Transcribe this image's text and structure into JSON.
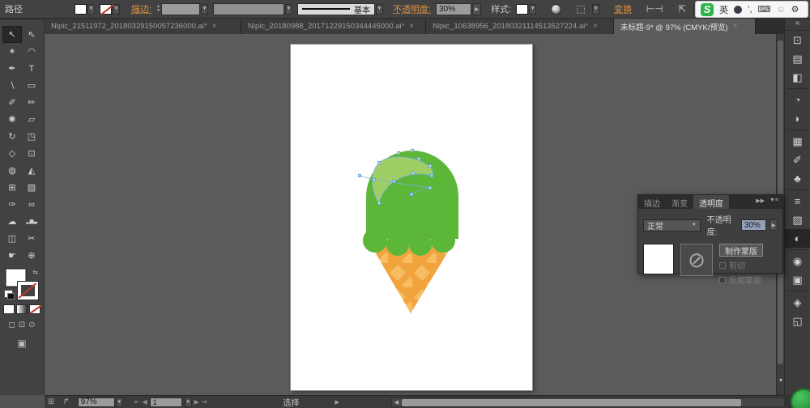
{
  "top_bar": {
    "context_label": "路径",
    "stroke_link": "描边:",
    "stroke_style_value": "基本",
    "opacity_link": "不透明度:",
    "opacity_value": "30%",
    "style_label": "样式:",
    "transform_link": "变换"
  },
  "ime": {
    "logo": "S",
    "mode": "英",
    "punct": "’,",
    "keyboard": "⌨",
    "skin": "☺",
    "tools": "⚙"
  },
  "tabs": {
    "items": [
      {
        "label": "Nipic_21511972_20180329150057236000.ai*",
        "close": "×",
        "active": false
      },
      {
        "label": "Nipic_20180988_20171229150344445000.ai*",
        "close": "×",
        "active": false
      },
      {
        "label": "Nipic_10638956_20180321114513527224.ai*",
        "close": "×",
        "active": false
      },
      {
        "label": "未标题-9* @ 97% (CMYK/预览)",
        "close": "×",
        "active": true
      }
    ],
    "overflow": "»"
  },
  "toolbar": {
    "tools": [
      {
        "name": "selection-tool",
        "glyph": "↖",
        "active": true
      },
      {
        "name": "direct-selection-tool",
        "glyph": "⇖"
      },
      {
        "name": "magic-wand-tool",
        "glyph": "✶"
      },
      {
        "name": "lasso-tool",
        "glyph": "◠"
      },
      {
        "name": "pen-tool",
        "glyph": "✒"
      },
      {
        "name": "type-tool",
        "glyph": "T"
      },
      {
        "name": "line-segment-tool",
        "glyph": "∖"
      },
      {
        "name": "rectangle-tool",
        "glyph": "▭"
      },
      {
        "name": "paintbrush-tool",
        "glyph": "✐"
      },
      {
        "name": "pencil-tool",
        "glyph": "✏"
      },
      {
        "name": "blob-brush-tool",
        "glyph": "✺"
      },
      {
        "name": "eraser-tool",
        "glyph": "▱"
      },
      {
        "name": "rotate-tool",
        "glyph": "↻"
      },
      {
        "name": "scale-tool",
        "glyph": "◳"
      },
      {
        "name": "width-tool",
        "glyph": "◇"
      },
      {
        "name": "free-transform-tool",
        "glyph": "⊡"
      },
      {
        "name": "shape-builder-tool",
        "glyph": "◍"
      },
      {
        "name": "perspective-grid-tool",
        "glyph": "◭"
      },
      {
        "name": "mesh-tool",
        "glyph": "⊞"
      },
      {
        "name": "gradient-tool",
        "glyph": "▨"
      },
      {
        "name": "eyedropper-tool",
        "glyph": "✑"
      },
      {
        "name": "blend-tool",
        "glyph": "∞"
      },
      {
        "name": "symbol-sprayer-tool",
        "glyph": "☁"
      },
      {
        "name": "column-graph-tool",
        "glyph": "▂▆▃"
      },
      {
        "name": "artboard-tool",
        "glyph": "◫"
      },
      {
        "name": "slice-tool",
        "glyph": "✂"
      },
      {
        "name": "hand-tool",
        "glyph": "☛"
      },
      {
        "name": "zoom-tool",
        "glyph": "⊕"
      }
    ]
  },
  "dock": {
    "expand": "«",
    "groups": [
      [
        {
          "name": "transform-panel-icon",
          "glyph": "⊡"
        },
        {
          "name": "align-panel-icon",
          "glyph": "▤"
        },
        {
          "name": "pathfinder-panel-icon",
          "glyph": "◧"
        }
      ],
      [
        {
          "name": "navigator-panel-icon",
          "glyph": "◔"
        },
        {
          "name": "color-panel-icon",
          "glyph": "◗"
        }
      ],
      [
        {
          "name": "swatches-panel-icon",
          "glyph": "▦"
        },
        {
          "name": "brushes-panel-icon",
          "glyph": "✐"
        },
        {
          "name": "symbols-panel-icon",
          "glyph": "♣"
        }
      ],
      [
        {
          "name": "stroke-panel-icon",
          "glyph": "≡"
        },
        {
          "name": "gradient-panel-icon",
          "glyph": "▨"
        },
        {
          "name": "transparency-panel-icon",
          "glyph": "◐",
          "active": true
        }
      ],
      [
        {
          "name": "appearance-panel-icon",
          "glyph": "◉"
        },
        {
          "name": "graphic-styles-panel-icon",
          "glyph": "▣"
        }
      ],
      [
        {
          "name": "layers-panel-icon",
          "glyph": "◈"
        },
        {
          "name": "artboards-panel-icon",
          "glyph": "◱"
        }
      ]
    ]
  },
  "panel": {
    "tab_stroke": "描边",
    "tab_gradient": "渐变",
    "tab_transparency": "透明度",
    "collapse_icon": "▶▶",
    "menu_icon": "▼≡",
    "blend_mode": "正常",
    "opacity_label": "不透明度:",
    "opacity_value": "30%",
    "no_symbol": "⊘",
    "make_mask_label": "制作蒙版",
    "clip_label": "剪切",
    "invert_mask_label": "反相蒙版"
  },
  "status_bar": {
    "zoom_value": "97%",
    "artboard_value": "1",
    "selection_label": "选择"
  },
  "glyphs": {
    "dropdown": "▼",
    "up": "▲",
    "right": "▶",
    "left": "◀",
    "first": "⇤",
    "last": "⇥",
    "swap": "⇆",
    "dashed_select": "⬚",
    "align": "⊢⊣",
    "isolate": "⇱",
    "doc_icon": "⊞",
    "share_icon": "↱"
  },
  "colors": {
    "scoop_green": "#5cb637",
    "highlight_green": "#a7d06c",
    "cone_orange": "#f1a43d",
    "cone_diamond": "#f6bd63",
    "anchor_blue": "#5b9bd5",
    "anchor_fill": "#cfe3f4",
    "path_blue": "#74aede",
    "ime_green": "#2fb34c"
  }
}
